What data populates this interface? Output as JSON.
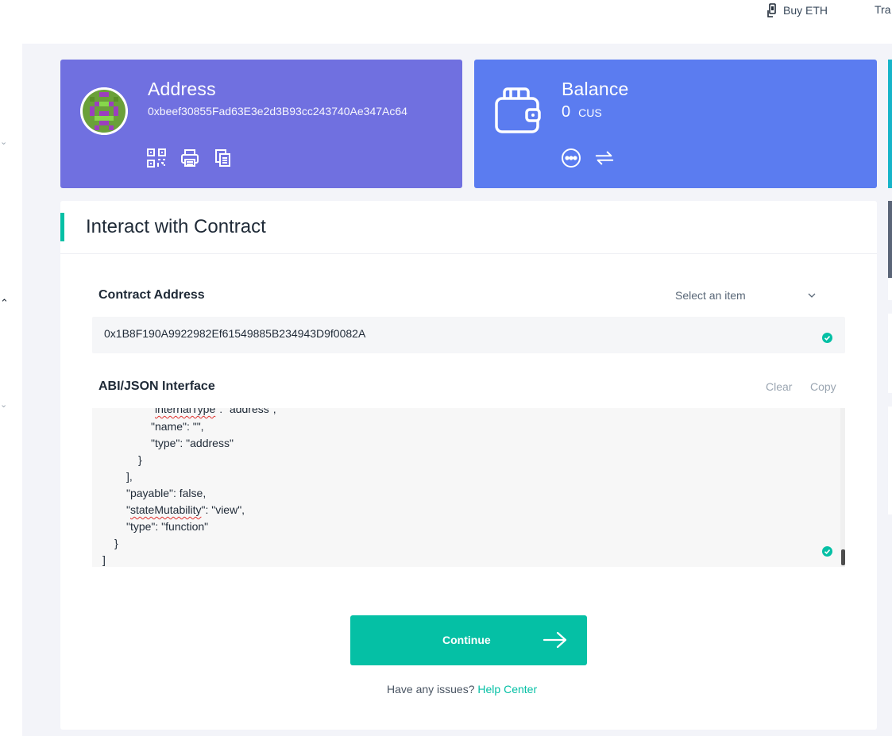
{
  "topnav": {
    "buy_label": "Buy ETH",
    "next_label": "Tra"
  },
  "address_card": {
    "title": "Address",
    "address": "0xbeef30855Fad63E3e2d3B93cc243740Ae347Ac64",
    "icons": [
      "qr-code-icon",
      "printer-icon",
      "copy-icon"
    ]
  },
  "balance_card": {
    "title": "Balance",
    "value": "0",
    "unit": "CUS",
    "icons": [
      "more-icon",
      "swap-icon"
    ]
  },
  "panel": {
    "title": "Interact with Contract",
    "contract_address": {
      "label": "Contract Address",
      "select_placeholder": "Select an item",
      "value": "0x1B8F190A9922982Ef61549885B234943D9f0082A"
    },
    "abi": {
      "label": "ABI/JSON Interface",
      "clear_label": "Clear",
      "copy_label": "Copy",
      "lines": [
        "\"internalType\": \"address\",",
        "\"name\": \"\",",
        "\"type\": \"address\"",
        "}",
        "],",
        "\"payable\": false,",
        "\"stateMutability\": \"view\",",
        "\"type\": \"function\"",
        "}",
        "]"
      ]
    },
    "continue_label": "Continue",
    "help_text": "Have any issues?",
    "help_link": "Help Center"
  },
  "colors": {
    "address_card": "#7070e0",
    "balance_card": "#5b7cf0",
    "accent": "#05c0a5"
  }
}
